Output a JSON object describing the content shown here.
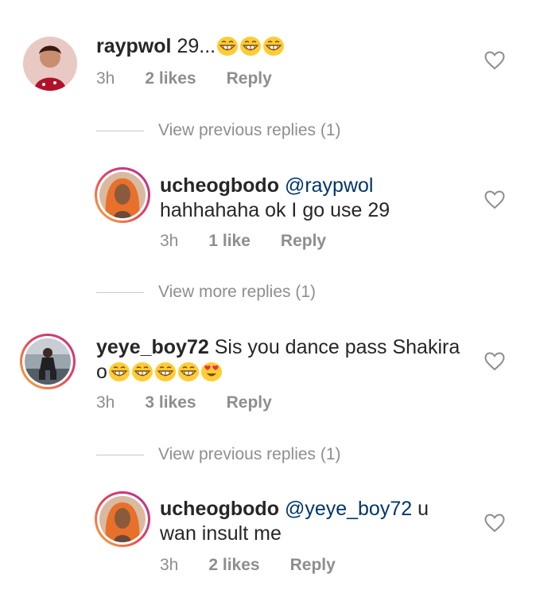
{
  "comments": [
    {
      "username": "raypwol",
      "text": "29...",
      "emojis": [
        "grin",
        "grin",
        "grin"
      ],
      "time": "3h",
      "likes": "2 likes",
      "reply": "Reply"
    },
    {
      "username": "ucheogbodo",
      "mention": "@raypwol",
      "text": "hahhahaha ok I go use 29",
      "time": "3h",
      "likes": "1 like",
      "reply": "Reply"
    },
    {
      "username": "yeye_boy72",
      "text": "Sis you dance pass Shakira",
      "text2": "o",
      "emojis": [
        "grin",
        "grin",
        "grin",
        "grin",
        "heart-eyes"
      ],
      "time": "3h",
      "likes": "3 likes",
      "reply": "Reply"
    },
    {
      "username": "ucheogbodo",
      "mention": "@yeye_boy72",
      "text": "u",
      "text2": "wan insult me",
      "time": "3h",
      "likes": "2 likes",
      "reply": "Reply"
    }
  ],
  "view_replies": [
    "View previous replies (1)",
    "View more replies (1)",
    "View previous replies (1)"
  ],
  "colors": {
    "text": "#262626",
    "meta": "#8e8e8e",
    "mention": "#003569"
  }
}
